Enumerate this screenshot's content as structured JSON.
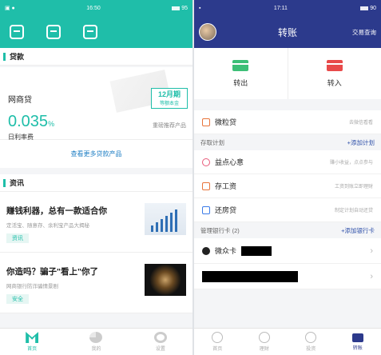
{
  "left": {
    "status": {
      "time": "16:50",
      "right": "95"
    },
    "loans": {
      "section_title": "贷款",
      "product_name": "网商贷",
      "rate": "0.035",
      "rate_unit": "%",
      "rate_label": "日利率费",
      "period": "12月期",
      "period_sub": "等额本金",
      "recommend": "重磅推荐产品",
      "more_link": "查看更多贷款产品"
    },
    "news": {
      "section_title": "资讯",
      "items": [
        {
          "title": "赚钱利器，总有一款适合你",
          "subtitle": "定活宝、随意存、余利宝产品大揭秘",
          "tag": "资讯"
        },
        {
          "title": "你造吗？骗子\"看上\"你了",
          "subtitle": "网商银行防诈骗情景剧",
          "tag": "安全"
        }
      ]
    },
    "tabs": [
      {
        "label": "首页",
        "icon": "home-icon"
      },
      {
        "label": "我的",
        "icon": "pie-chart-icon"
      },
      {
        "label": "设置",
        "icon": "gear-icon"
      }
    ]
  },
  "right": {
    "status": {
      "time": "17:11",
      "right": "90"
    },
    "header": {
      "title": "转账",
      "query": "交易查询"
    },
    "transfer_out": "转出",
    "transfer_in": "转入",
    "micro_loan": {
      "label": "微粒贷",
      "sub": "去微信看看"
    },
    "plans": {
      "head": "存取计划",
      "add": "+添加计划",
      "items": [
        {
          "label": "益点心意",
          "sub": "赚小收益，点点参与"
        },
        {
          "label": "存工资",
          "sub": "工资到账立即理财"
        },
        {
          "label": "还房贷",
          "sub": "制定计划自动还贷"
        }
      ]
    },
    "cards": {
      "head": "管理银行卡",
      "count": "(2)",
      "add": "+添加银行卡",
      "first_label": "微众卡"
    },
    "tabs": [
      {
        "label": "首页",
        "icon": "clock-icon"
      },
      {
        "label": "理财",
        "icon": "person-icon"
      },
      {
        "label": "投资",
        "icon": "compass-icon"
      },
      {
        "label": "转账",
        "icon": "card-icon"
      }
    ]
  }
}
